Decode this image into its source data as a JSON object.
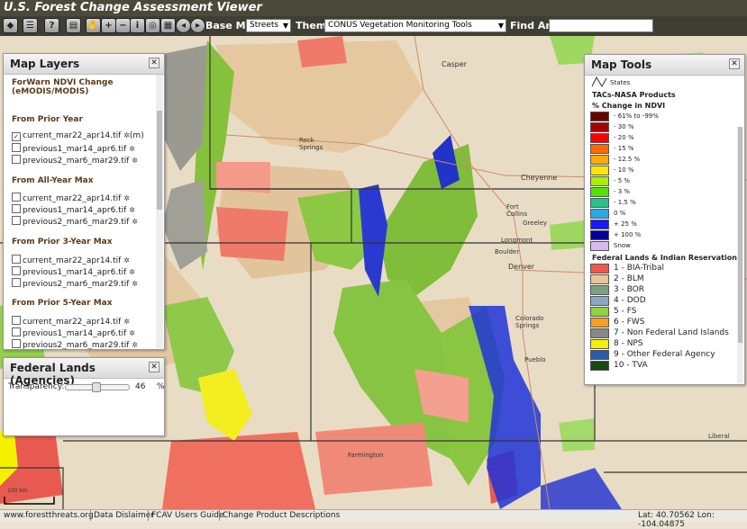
{
  "app": {
    "title": "U.S. Forest Change Assessment Viewer"
  },
  "toolbar": {
    "basemap_label": "Base Map:",
    "basemap_value": "Streets",
    "theme_label": "Theme:",
    "theme_value": "CONUS Vegetation Monitoring Tools",
    "find_label": "Find Area:",
    "find_value": ""
  },
  "map_labels": {
    "casper": "Casper",
    "rock_springs": "Rock Springs",
    "cheyenne": "Cheyenne",
    "fort_collins": "Fort Collins",
    "greeley": "Greeley",
    "longmont": "Longmont",
    "boulder": "Boulder",
    "denver": "Denver",
    "colorado_springs": "Colorado Springs",
    "pueblo": "Pueblo",
    "farmington": "Farmington",
    "liberal": "Liberal",
    "scale": "100 km"
  },
  "layers_panel": {
    "title": "Map Layers",
    "product": "ForWarn NDVI Change (eMODIS/MODIS)",
    "sections": [
      {
        "heading": "From Prior Year",
        "items": [
          {
            "label": "current_mar22_apr14.tif",
            "checked": true,
            "suffix": "(m)"
          },
          {
            "label": "previous1_mar14_apr6.tif",
            "checked": false,
            "suffix": ""
          },
          {
            "label": "previous2_mar6_mar29.tif",
            "checked": false,
            "suffix": ""
          }
        ]
      },
      {
        "heading": "From All-Year Max",
        "items": [
          {
            "label": "current_mar22_apr14.tif",
            "checked": false,
            "suffix": ""
          },
          {
            "label": "previous1_mar14_apr6.tif",
            "checked": false,
            "suffix": ""
          },
          {
            "label": "previous2_mar6_mar29.tif",
            "checked": false,
            "suffix": ""
          }
        ]
      },
      {
        "heading": "From Prior 3-Year Max",
        "items": [
          {
            "label": "current_mar22_apr14.tif",
            "checked": false,
            "suffix": ""
          },
          {
            "label": "previous1_mar14_apr6.tif",
            "checked": false,
            "suffix": ""
          },
          {
            "label": "previous2_mar6_mar29.tif",
            "checked": false,
            "suffix": ""
          }
        ]
      },
      {
        "heading": "From Prior 5-Year Max",
        "items": [
          {
            "label": "current_mar22_apr14.tif",
            "checked": false,
            "suffix": ""
          },
          {
            "label": "previous1_mar14_apr6.tif",
            "checked": false,
            "suffix": ""
          },
          {
            "label": "previous2_mar6_mar29.tif",
            "checked": false,
            "suffix": ""
          }
        ]
      }
    ]
  },
  "fed_panel": {
    "title": "Federal Lands (Agencies)",
    "transparency_label": "Transparency:",
    "transparency_value": "46",
    "transparency_unit": "%",
    "transparency_fraction": 0.46
  },
  "tools_panel": {
    "title": "Map Tools",
    "states_label": "States",
    "product_heading": "TACs-NASA Products",
    "ndvi_heading": "% Change in NDVI",
    "ndvi_legend": [
      {
        "label": "- 61% to -99%",
        "color": "#6b0000"
      },
      {
        "label": "- 30 %",
        "color": "#a80000"
      },
      {
        "label": "- 20 %",
        "color": "#ff0000"
      },
      {
        "label": "- 15 %",
        "color": "#ff6a00"
      },
      {
        "label": "- 12.5 %",
        "color": "#ffaa00"
      },
      {
        "label": "- 10 %",
        "color": "#ffe600"
      },
      {
        "label": "- 5 %",
        "color": "#a8f000"
      },
      {
        "label": "- 3 %",
        "color": "#4ce600"
      },
      {
        "label": "- 1.5 %",
        "color": "#22c48c"
      },
      {
        "label": "0 %",
        "color": "#2aa8e0"
      },
      {
        "label": "+ 25 %",
        "color": "#1a1aff"
      },
      {
        "label": "+ 100 %",
        "color": "#00009c"
      },
      {
        "label": "Snow",
        "color": "#d9b8ee"
      }
    ],
    "fed_heading": "Federal Lands & Indian Reservations",
    "fed_legend": [
      {
        "label": "1 - BIA-Tribal",
        "color": "#f0564a"
      },
      {
        "label": "2 - BLM",
        "color": "#e8c498"
      },
      {
        "label": "3 - BOR",
        "color": "#7da080"
      },
      {
        "label": "4 - DOD",
        "color": "#8aa8c4"
      },
      {
        "label": "5 - FS",
        "color": "#8ed43a"
      },
      {
        "label": "6 - FWS",
        "color": "#f5a020"
      },
      {
        "label": "7 - Non Federal Land Islands",
        "color": "#888888"
      },
      {
        "label": "8 - NPS",
        "color": "#f5f000"
      },
      {
        "label": "9 - Other Federal Agency",
        "color": "#2a5aa8"
      },
      {
        "label": "10 - TVA",
        "color": "#1a4a14"
      }
    ]
  },
  "status": {
    "links": [
      "www.forestthreats.org",
      "Data Dislaimer",
      "FCAV Users Guide",
      "Change Product Descriptions"
    ],
    "coords": "Lat: 40.70562 Lon: -104.04875"
  }
}
